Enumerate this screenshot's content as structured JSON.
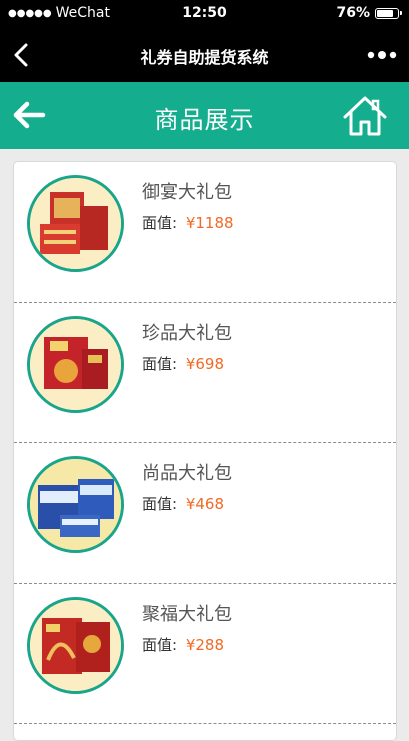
{
  "status_bar": {
    "signal_dots": "●●●●●",
    "carrier": "WeChat",
    "time": "12:50",
    "battery": "76%"
  },
  "wechat_bar": {
    "title": "礼券自助提货系统"
  },
  "page_header": {
    "title": "商品展示"
  },
  "colors": {
    "header_bg": "#14ad8d",
    "price": "#f06a25",
    "thumb_border": "#1aa58b"
  },
  "products": [
    {
      "name": "御宴大礼包",
      "price_label": "面值:",
      "price": "¥1188",
      "box_color": "#c8312a"
    },
    {
      "name": "珍品大礼包",
      "price_label": "面值:",
      "price": "¥698",
      "box_color": "#c4232a"
    },
    {
      "name": "尚品大礼包",
      "price_label": "面值:",
      "price": "¥468",
      "box_color": "#2a4fa8"
    },
    {
      "name": "聚福大礼包",
      "price_label": "面值:",
      "price": "¥288",
      "box_color": "#c32a24"
    }
  ]
}
